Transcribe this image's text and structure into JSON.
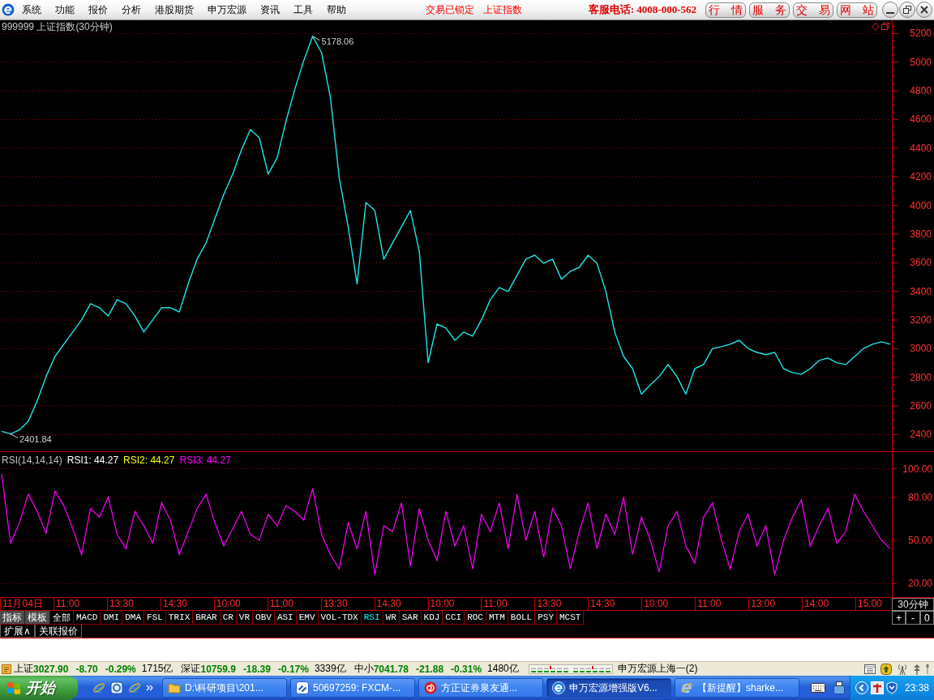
{
  "menu_bar": {
    "items": [
      "系统",
      "功能",
      "报价",
      "分析",
      "港股期货",
      "申万宏源",
      "资讯",
      "工具",
      "帮助"
    ],
    "lock_status": "交易已锁定",
    "index_link": "上证指数",
    "hotline": "客服电话: 4008-000-562",
    "buttons": [
      "行 情",
      "服 务",
      "交 易",
      "网 站"
    ]
  },
  "price_chart": {
    "chart_data": {
      "type": "line",
      "title": "999999 上证指数(30分钟)",
      "grid": true,
      "ylim": [
        2281,
        5290
      ],
      "yticks": [
        2400,
        2600,
        2800,
        3000,
        3200,
        3400,
        3600,
        3800,
        4000,
        4200,
        4400,
        4600,
        4800,
        5000,
        5200
      ],
      "series": [
        {
          "color": "#1ee6e6",
          "values": [
            2420,
            2402,
            2430,
            2490,
            2632,
            2802,
            2943,
            3028,
            3113,
            3198,
            3311,
            3283,
            3226,
            3339,
            3311,
            3226,
            3113,
            3198,
            3283,
            3283,
            3254,
            3452,
            3622,
            3735,
            3905,
            4074,
            4216,
            4386,
            4527,
            4470,
            4216,
            4329,
            4584,
            4810,
            5008,
            5178,
            5064,
            4753,
            4188,
            3848,
            3450,
            4018,
            3962,
            3622,
            3735,
            3848,
            3962,
            3679,
            2900,
            3169,
            3141,
            3056,
            3113,
            3085,
            3198,
            3339,
            3424,
            3396,
            3509,
            3622,
            3650,
            3594,
            3622,
            3481,
            3537,
            3565,
            3650,
            3594,
            3396,
            3113,
            2943,
            2858,
            2680,
            2745,
            2802,
            2887,
            2802,
            2680,
            2858,
            2887,
            2999,
            3011,
            3028,
            3056,
            2999,
            2971,
            2955,
            2971,
            2858,
            2830,
            2819,
            2858,
            2915,
            2932,
            2898,
            2887,
            2943,
            2999,
            3028,
            3045,
            3028
          ]
        }
      ],
      "annotations": [
        "5178.06",
        "2401.84"
      ]
    }
  },
  "rsi_panel": {
    "legend": [
      {
        "label": "RSI1: 44.27",
        "color": "#ffffff"
      },
      {
        "label": "RSI2: 44.27",
        "color": "#ffff00"
      },
      {
        "label": "RSI3: 44.27",
        "color": "#ff00ff"
      }
    ],
    "chart_data": {
      "type": "line",
      "title": "RSI(14,14,14)",
      "grid": true,
      "ylim": [
        10.4,
        100
      ],
      "yticks": [
        {
          "value": 100,
          "label": "100.00"
        },
        {
          "value": 80,
          "label": "80.00"
        },
        {
          "value": 50,
          "label": "50.00"
        },
        {
          "value": 20,
          "label": "20.00"
        }
      ],
      "series": [
        {
          "color": "#ff00ff",
          "values": [
            96,
            48,
            62,
            82,
            70,
            55,
            84,
            74,
            58,
            40,
            72,
            66,
            80,
            54,
            44,
            70,
            60,
            48,
            76,
            64,
            40,
            56,
            72,
            82,
            62,
            46,
            58,
            70,
            54,
            50,
            68,
            60,
            74,
            70,
            64,
            86,
            54,
            40,
            30,
            62,
            44,
            70,
            26,
            60,
            56,
            76,
            32,
            72,
            50,
            36,
            70,
            46,
            60,
            30,
            68,
            56,
            76,
            44,
            82,
            50,
            70,
            38,
            72,
            60,
            30,
            56,
            76,
            44,
            68,
            54,
            80,
            40,
            66,
            50,
            28,
            60,
            70,
            46,
            34,
            66,
            76,
            50,
            30,
            56,
            68,
            46,
            60,
            26,
            50,
            66,
            78,
            46,
            60,
            72,
            48,
            56,
            82,
            70,
            60,
            50,
            44
          ]
        }
      ]
    }
  },
  "time_axis": {
    "labels": [
      "11月04日",
      "11:00",
      "13:30",
      "14:30",
      "10:00",
      "11:00",
      "13:30",
      "14:30",
      "10:00",
      "11:00",
      "13:30",
      "14:30",
      "10:00",
      "11:00",
      "13:00",
      "14:00",
      "15:00"
    ],
    "period": "30分钟"
  },
  "indicator_bar": {
    "tools": [
      "指标",
      "模板"
    ],
    "indicators": [
      {
        "label": "全部",
        "selected": false
      },
      {
        "label": "MACD",
        "selected": false
      },
      {
        "label": "DMI",
        "selected": false
      },
      {
        "label": "DMA",
        "selected": false
      },
      {
        "label": "FSL",
        "selected": false
      },
      {
        "label": "TRIX",
        "selected": false
      },
      {
        "label": "BRAR",
        "selected": false
      },
      {
        "label": "CR",
        "selected": false
      },
      {
        "label": "VR",
        "selected": false
      },
      {
        "label": "OBV",
        "selected": false
      },
      {
        "label": "ASI",
        "selected": false
      },
      {
        "label": "EMV",
        "selected": false
      },
      {
        "label": "VOL-TDX",
        "selected": false
      },
      {
        "label": "RSI",
        "selected": true
      },
      {
        "label": "WR",
        "selected": false
      },
      {
        "label": "SAR",
        "selected": false
      },
      {
        "label": "KDJ",
        "selected": false
      },
      {
        "label": "CCI",
        "selected": false
      },
      {
        "label": "ROC",
        "selected": false
      },
      {
        "label": "MTM",
        "selected": false
      },
      {
        "label": "BOLL",
        "selected": false
      },
      {
        "label": "PSY",
        "selected": false
      },
      {
        "label": "MCST",
        "selected": false
      }
    ],
    "zoom_buttons": [
      "+",
      "-",
      "0"
    ]
  },
  "bottom_tabs": [
    "扩展∧",
    "关联报价"
  ],
  "status_bar": {
    "indices": [
      {
        "name": "上证",
        "value": "3027.90",
        "change": "-8.70",
        "percent": "-0.29%",
        "turnover": "1715亿"
      },
      {
        "name": "深证",
        "value": "10759.9",
        "change": "-18.39",
        "percent": "-0.17%",
        "turnover": "3339亿"
      },
      {
        "name": "中小",
        "value": "7041.78",
        "change": "-21.88",
        "percent": "-0.31%",
        "turnover": "1480亿"
      }
    ],
    "broker": "申万宏源上海一(2)"
  },
  "taskbar": {
    "start": "开始",
    "tasks": [
      {
        "label": "D:\\科研项目\\201...",
        "kind": "folder",
        "selected": false
      },
      {
        "label": "50697259: FXCM-...",
        "kind": "square",
        "selected": false
      },
      {
        "label": "方正证券泉友通...",
        "kind": "swirl",
        "selected": false
      },
      {
        "label": "申万宏源增强版V6...",
        "kind": "circle",
        "selected": true
      },
      {
        "label": "【新提醒】sharke...",
        "kind": "browser",
        "selected": false
      }
    ],
    "clock": "23:38"
  }
}
